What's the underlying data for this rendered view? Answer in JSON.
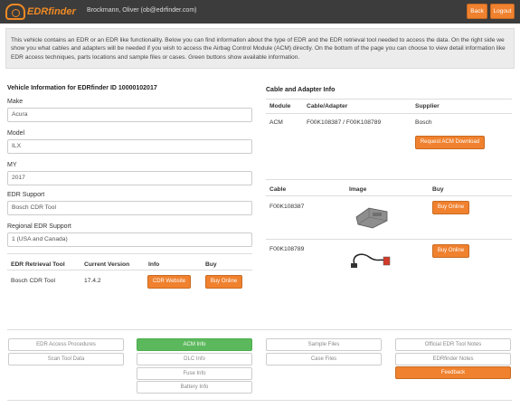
{
  "header": {
    "brand": "EDRfinder",
    "user": "Brockmann, Oliver (ob@edrfinder.com)",
    "back_label": "Back",
    "logout_label": "Logout"
  },
  "info_text": "This vehicle contains an EDR or an EDR like functionality. Below you can find information about the type of EDR and the EDR retrieval tool needed to access the data. On the right side we show you what cables and adapters will be needed if you wish to access the Airbag Control Module (ACM) directly. On the bottom of the page you can choose to view detail information like EDR access techniques, parts locations and sample files or cases. Green buttons show available information.",
  "vehicle": {
    "heading": "Vehicle Information for EDRfinder ID 10000102017",
    "make_label": "Make",
    "make": "Acura",
    "model_label": "Model",
    "model": "ILX",
    "my_label": "MY",
    "my": "2017",
    "edr_support_label": "EDR Support",
    "edr_support": "Bosch CDR Tool",
    "regional_label": "Regional EDR Support",
    "regional": "1 (USA and Canada)"
  },
  "retrieval": {
    "headers": [
      "EDR Retrieval Tool",
      "Current Version",
      "Info",
      "Buy"
    ],
    "tool": "Bosch CDR Tool",
    "version": "17.4.2",
    "website_label": "CDR Website",
    "buy_label": "Buy Online"
  },
  "cable_adapter": {
    "heading": "Cable and Adapter Info",
    "headers": [
      "Module",
      "Cable/Adapter",
      "Supplier"
    ],
    "module": "ACM",
    "cable": "F00K108387 / F00K108789",
    "supplier": "Bosch",
    "request_label": "Request ACM Download"
  },
  "cables": {
    "headers": [
      "Cable",
      "Image",
      "Buy"
    ],
    "rows": [
      {
        "cable": "F00K108387",
        "buy_label": "Buy Online"
      },
      {
        "cable": "F00K108789",
        "buy_label": "Buy Online"
      }
    ]
  },
  "bottom": {
    "edr_access": "EDR Access Procedures",
    "scan_tool": "Scan Tool Data",
    "acm_info": "ACM Info",
    "dlc_info": "DLC Info",
    "fuse_info": "Fuse Info",
    "battery_info": "Battery Info",
    "sample_files": "Sample Files",
    "case_files": "Case Files",
    "official_notes": "Official EDR Tool Notes",
    "edrfinder_notes": "EDRfinder Notes",
    "feedback": "Feedback"
  },
  "colors": {
    "accent": "#f0812e",
    "available": "#5cb85c",
    "header_bg": "#3c3c3c"
  }
}
